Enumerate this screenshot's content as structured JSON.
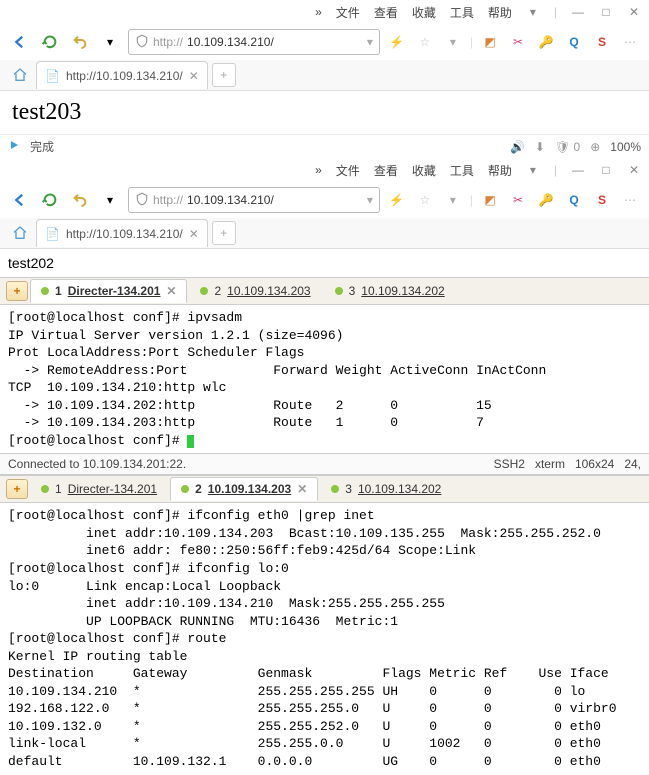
{
  "browser1": {
    "menus": {
      "chevrons": "»",
      "file": "文件",
      "view": "查看",
      "fav": "收藏",
      "tools": "工具",
      "help": "帮助"
    },
    "url_prefix": "http://",
    "url_host": "10.109.134.210/",
    "tab_title": "http://10.109.134.210/",
    "page_body": "test203"
  },
  "status1": {
    "done": "完成",
    "zoom": "100%"
  },
  "browser2": {
    "menus": {
      "chevrons": "»",
      "file": "文件",
      "view": "查看",
      "fav": "收藏",
      "tools": "工具",
      "help": "帮助"
    },
    "url_prefix": "http://",
    "url_host": "10.109.134.210/",
    "tab_title": "http://10.109.134.210/",
    "page_body": "test202"
  },
  "term1": {
    "tabs": [
      {
        "num": "1",
        "label": "Directer-134.201",
        "active": true
      },
      {
        "num": "2",
        "label": "10.109.134.203",
        "active": false
      },
      {
        "num": "3",
        "label": "10.109.134.202",
        "active": false
      }
    ],
    "lines": [
      "[root@localhost conf]# ipvsadm",
      "IP Virtual Server version 1.2.1 (size=4096)",
      "Prot LocalAddress:Port Scheduler Flags",
      "  -> RemoteAddress:Port           Forward Weight ActiveConn InActConn",
      "TCP  10.109.134.210:http wlc",
      "  -> 10.109.134.202:http          Route   2      0          15",
      "  -> 10.109.134.203:http          Route   1      0          7",
      "[root@localhost conf]# "
    ],
    "status_left": "Connected to 10.109.134.201:22.",
    "status_right": {
      "ssh": "SSH2",
      "term": "xterm",
      "size": "106x24",
      "pos": "24,"
    }
  },
  "term2": {
    "tabs": [
      {
        "num": "1",
        "label": "Directer-134.201",
        "active": false
      },
      {
        "num": "2",
        "label": "10.109.134.203",
        "active": true
      },
      {
        "num": "3",
        "label": "10.109.134.202",
        "active": false
      }
    ],
    "lines": [
      "[root@localhost conf]# ifconfig eth0 |grep inet",
      "          inet addr:10.109.134.203  Bcast:10.109.135.255  Mask:255.255.252.0",
      "          inet6 addr: fe80::250:56ff:feb9:425d/64 Scope:Link",
      "[root@localhost conf]# ifconfig lo:0",
      "lo:0      Link encap:Local Loopback",
      "          inet addr:10.109.134.210  Mask:255.255.255.255",
      "          UP LOOPBACK RUNNING  MTU:16436  Metric:1",
      "[root@localhost conf]# route",
      "Kernel IP routing table",
      "Destination     Gateway         Genmask         Flags Metric Ref    Use Iface",
      "10.109.134.210  *               255.255.255.255 UH    0      0        0 lo",
      "192.168.122.0   *               255.255.255.0   U     0      0        0 virbr0",
      "10.109.132.0    *               255.255.252.0   U     0      0        0 eth0",
      "link-local      *               255.255.0.0     U     1002   0        0 eth0",
      "default         10.109.132.1    0.0.0.0         UG    0      0        0 eth0"
    ]
  }
}
